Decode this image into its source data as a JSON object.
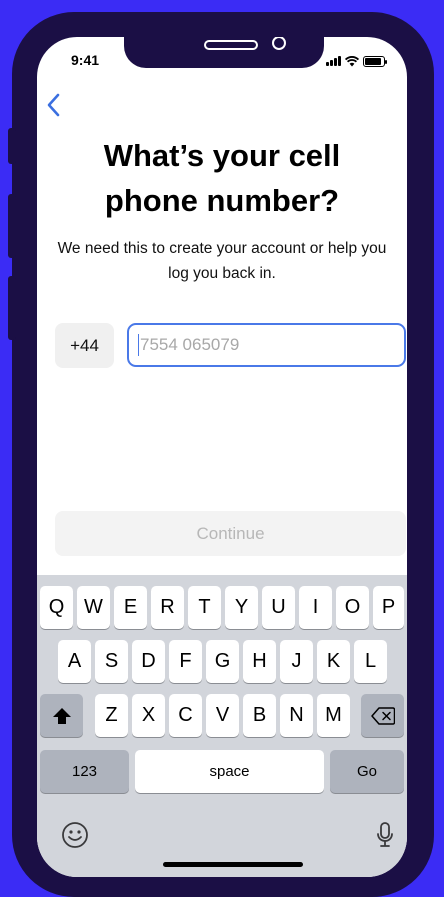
{
  "status_bar": {
    "time": "9:41"
  },
  "header": {
    "back_icon": "chevron-left-icon"
  },
  "title": "What’s your cell phone number?",
  "subtitle": "We need this to create your account or help you log you back in.",
  "country_code": "+44",
  "phone": {
    "value": "",
    "placeholder": "7554 065079"
  },
  "continue_label": "Continue",
  "keyboard": {
    "row1": [
      "Q",
      "W",
      "E",
      "R",
      "T",
      "Y",
      "U",
      "I",
      "O",
      "P"
    ],
    "row2": [
      "A",
      "S",
      "D",
      "F",
      "G",
      "H",
      "J",
      "K",
      "L"
    ],
    "row3": [
      "Z",
      "X",
      "C",
      "V",
      "B",
      "N",
      "M"
    ],
    "numbers_label": "123",
    "space_label": "space",
    "go_label": "Go"
  },
  "colors": {
    "background": "#3b2cf5",
    "device": "#1b0f45",
    "accent": "#4a79e8"
  }
}
